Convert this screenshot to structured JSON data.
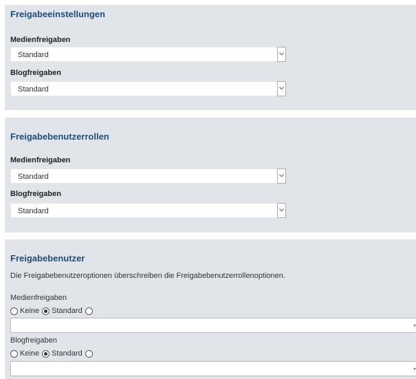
{
  "section1": {
    "title": "Freigabeeinstellungen",
    "media_label": "Medienfreigaben",
    "media_value": "Standard",
    "blog_label": "Blogfreigaben",
    "blog_value": "Standard"
  },
  "section2": {
    "title": "Freigabebenutzerrollen",
    "media_label": "Medienfreigaben",
    "media_value": "Standard",
    "blog_label": "Blogfreigaben",
    "blog_value": "Standard"
  },
  "section3": {
    "title": "Freigabebenutzer",
    "description": "Die Freigabebenutzeroptionen überschreiben die Freigabebenutzerrollenoptionen.",
    "media_label": "Medienfreigaben",
    "media_options": [
      {
        "label": "Keine",
        "checked": false
      },
      {
        "label": "Standard",
        "checked": true
      },
      {
        "label": "",
        "checked": false
      }
    ],
    "media_value": "",
    "blog_label": "Blogfreigaben",
    "blog_options": [
      {
        "label": "Keine",
        "checked": false
      },
      {
        "label": "Standard",
        "checked": true
      },
      {
        "label": "",
        "checked": false
      }
    ],
    "blog_value": ""
  }
}
